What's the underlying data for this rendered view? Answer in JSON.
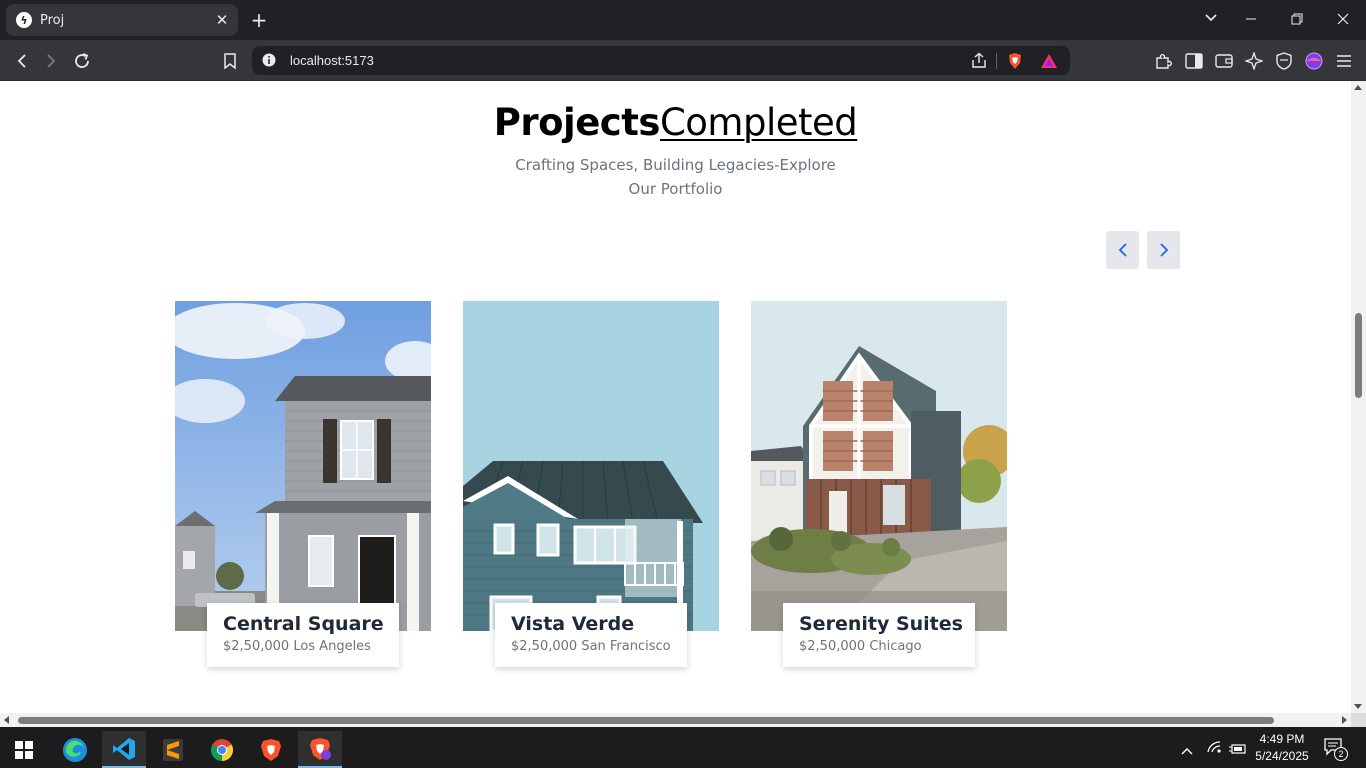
{
  "browser": {
    "tab_title": "Proj",
    "url": "localhost:5173",
    "shields_badge": "1"
  },
  "page": {
    "heading_bold": "Projects",
    "heading_light": "Completed",
    "subtitle": "Crafting Spaces, Building Legacies-Explore Our Portfolio",
    "projects": [
      {
        "name": "Central Square",
        "price": "$2,50,000",
        "location": "Los Angeles"
      },
      {
        "name": "Vista Verde",
        "price": "$2,50,000",
        "location": "San Francisco"
      },
      {
        "name": "Serenity Suites",
        "price": "$2,50,000",
        "location": "Chicago"
      }
    ]
  },
  "taskbar": {
    "time": "4:49 PM",
    "date": "5/24/2025",
    "notification_count": "2"
  },
  "colors": {
    "accent_blue": "#2563eb",
    "nav_button_bg": "#e5e7eb",
    "text_gray": "#6b7280"
  }
}
